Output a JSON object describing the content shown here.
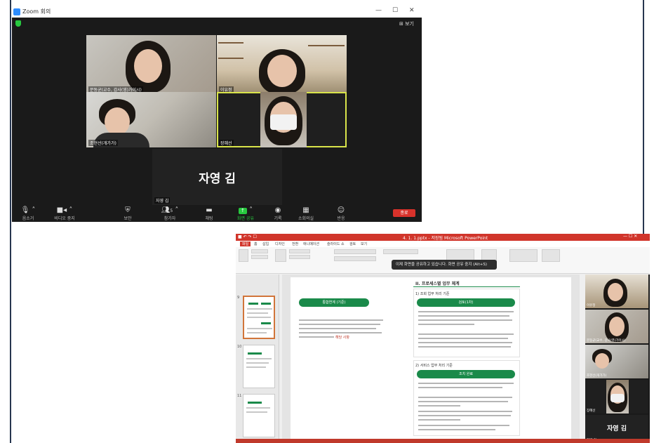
{
  "zoom": {
    "title": "Zoom 회의",
    "view_label": "보기",
    "participants": [
      {
        "name": "문동균(교수, 감사(영)가이시)"
      },
      {
        "name": "이유정"
      },
      {
        "name": "조현선(개가가)"
      },
      {
        "name": "장혜선"
      }
    ],
    "active_speaker": {
      "display": "자영 김",
      "name": "자영 김"
    },
    "toolbar": [
      {
        "icon": "microphone-icon",
        "label": "음소거"
      },
      {
        "icon": "video-camera-icon",
        "label": "비디오 중지"
      },
      {
        "icon": "shield-icon",
        "label": "보안"
      },
      {
        "icon": "participants-icon",
        "label": "참가자"
      },
      {
        "icon": "chat-icon",
        "label": "채팅"
      },
      {
        "icon": "share-screen-icon",
        "label": "화면 공유"
      },
      {
        "icon": "record-icon",
        "label": "기록"
      },
      {
        "icon": "breakout-rooms-icon",
        "label": "소회의실"
      },
      {
        "icon": "reactions-icon",
        "label": "반응"
      }
    ],
    "participants_count": "5",
    "end_label": "종료",
    "colors": {
      "share_button": "#27c93f",
      "end_button": "#d8322b",
      "active_border": "#d9e44a"
    }
  },
  "ppt": {
    "title": "4. 1. 1.pptx - 저장됨  Microsoft PowerPoint",
    "menu": [
      "파일",
      "홈",
      "삽입",
      "디자인",
      "전환",
      "애니메이션",
      "슬라이드 쇼",
      "검토",
      "보기"
    ],
    "toast": "이제 화면을 공유하고 있습니다. 화면 공유 중지 (Alt+S)",
    "slide_numbers": [
      "9",
      "10",
      "11"
    ],
    "slide": {
      "title": "II. 프로세스별 업무 체계",
      "section1": "1) 조회 업무 처리 기준",
      "left_pill": "통합연계 (기준)",
      "right_pill1": "검토(1차)",
      "section2": "2) 서비스 업무 처리 기준",
      "right_pill2": "조치 완료",
      "highlight": "해당 사항"
    },
    "gallery": [
      {
        "name": "이유정"
      },
      {
        "name": "문동균(교수, 감사(영)가이시)"
      },
      {
        "name": "조현선(개가가)"
      },
      {
        "name": "장혜선"
      }
    ],
    "active_speaker": {
      "display": "자영 김",
      "name": "자영 김"
    }
  }
}
